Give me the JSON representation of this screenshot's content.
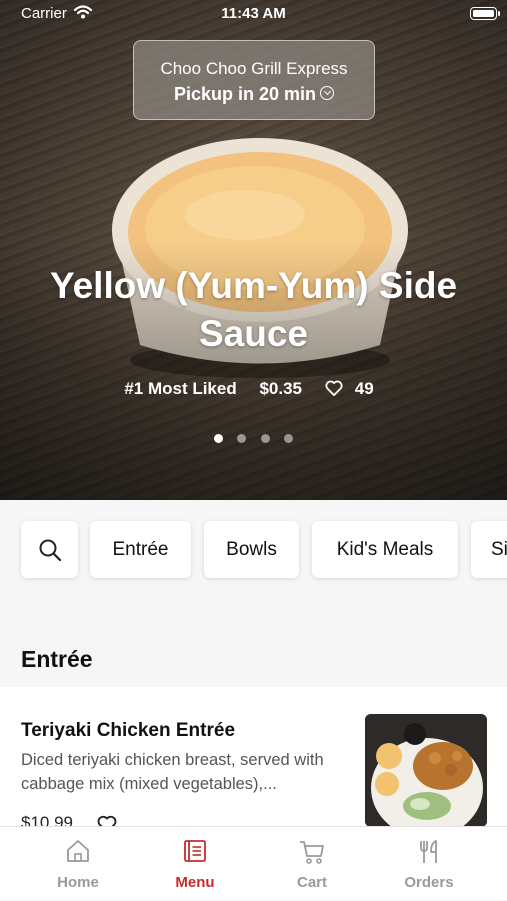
{
  "status_bar": {
    "carrier": "Carrier",
    "time": "11:43 AM"
  },
  "store": {
    "name": "Choo Choo Grill Express",
    "pickup": "Pickup in 20 min"
  },
  "featured": {
    "title": "Yellow (Yum-Yum) Side Sauce",
    "badge": "#1 Most Liked",
    "price": "$0.35",
    "likes": "49",
    "carousel_pages": 4,
    "carousel_active": 1
  },
  "categories": [
    "Entrée",
    "Bowls",
    "Kid's Meals",
    "Si"
  ],
  "section": {
    "title": "Entrée"
  },
  "items": [
    {
      "name": "Teriyaki Chicken Entrée",
      "description": "Diced teriyaki chicken breast, served with cabbage mix (mixed vegetables),...",
      "price": "$10.99"
    }
  ],
  "tabs": [
    {
      "label": "Home",
      "icon": "home-icon",
      "active": false
    },
    {
      "label": "Menu",
      "icon": "menu-icon",
      "active": true
    },
    {
      "label": "Cart",
      "icon": "cart-icon",
      "active": false
    },
    {
      "label": "Orders",
      "icon": "utensils-icon",
      "active": false
    }
  ],
  "colors": {
    "accent": "#c42c2c",
    "inactive_tab": "#9a9a9a",
    "background": "#f6f6f6"
  }
}
